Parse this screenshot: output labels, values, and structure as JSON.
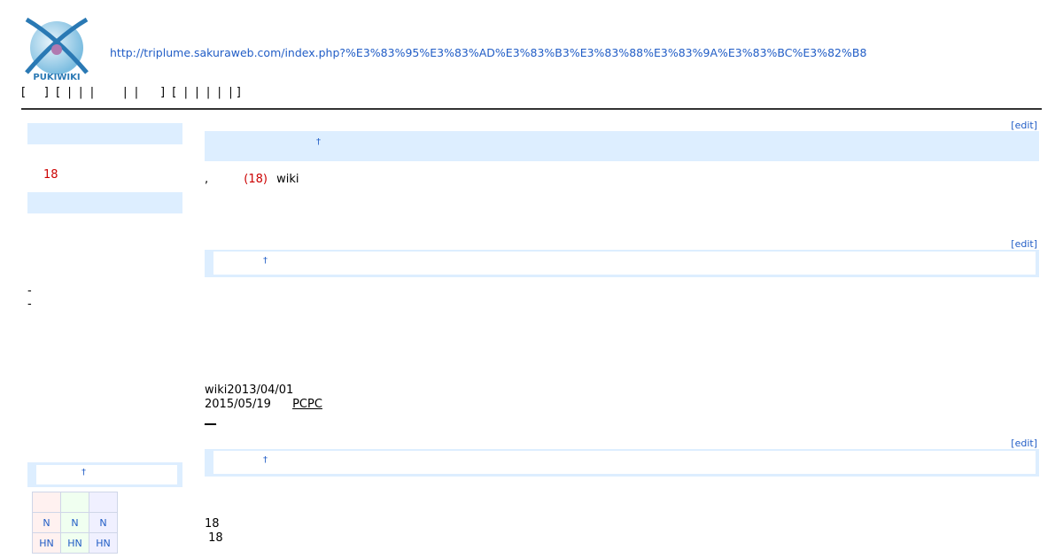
{
  "header": {
    "page_url": "http://triplume.sakuraweb.com/index.php?%E3%83%95%E3%83%AD%E3%83%B3%E3%83%88%E3%83%9A%E3%83%BC%E3%82%B8",
    "logo_text": "PUKIWIKI",
    "navbar": "[     ]  [  |  |  |        |  |      ]  [  |  |  |  |  | ]"
  },
  "menu": {
    "count": "18",
    "dashes": [
      "-",
      "-"
    ],
    "anchor": "†"
  },
  "calendar": {
    "rows": [
      [
        "",
        "",
        ""
      ],
      [
        "N",
        "N",
        "N"
      ],
      [
        "HN",
        "HN",
        "HN"
      ]
    ]
  },
  "main": {
    "edit_label": "[edit]",
    "anchor": "†",
    "intro": {
      "comma": ",",
      "count": "(18)",
      "wiki": "wiki"
    },
    "updates": {
      "line1": "wiki2013/04/01",
      "line2_date": "2015/05/19",
      "line2_link": "PCPC",
      "line3": "__"
    },
    "footer_counts": [
      "18",
      " 18"
    ]
  },
  "colors": {
    "link": "#215dc6",
    "heading_bg": "#ddeeff",
    "counter": "#cc0000"
  }
}
